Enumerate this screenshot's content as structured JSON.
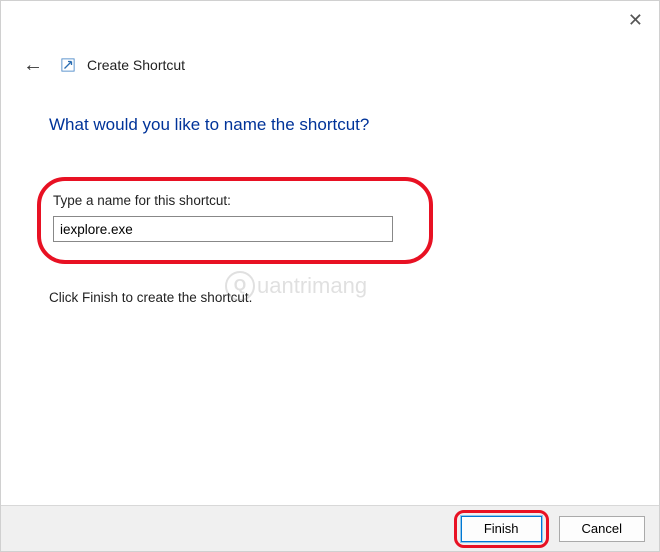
{
  "window": {
    "close_glyph": "✕"
  },
  "header": {
    "back_glyph": "←",
    "title": "Create Shortcut"
  },
  "main": {
    "question": "What would you like to name the shortcut?",
    "input_label": "Type a name for this shortcut:",
    "input_value": "iexplore.exe",
    "instruction": "Click Finish to create the shortcut."
  },
  "footer": {
    "finish_label": "Finish",
    "cancel_label": "Cancel"
  },
  "watermark": {
    "letter": "Q",
    "text": "uantrimang"
  }
}
